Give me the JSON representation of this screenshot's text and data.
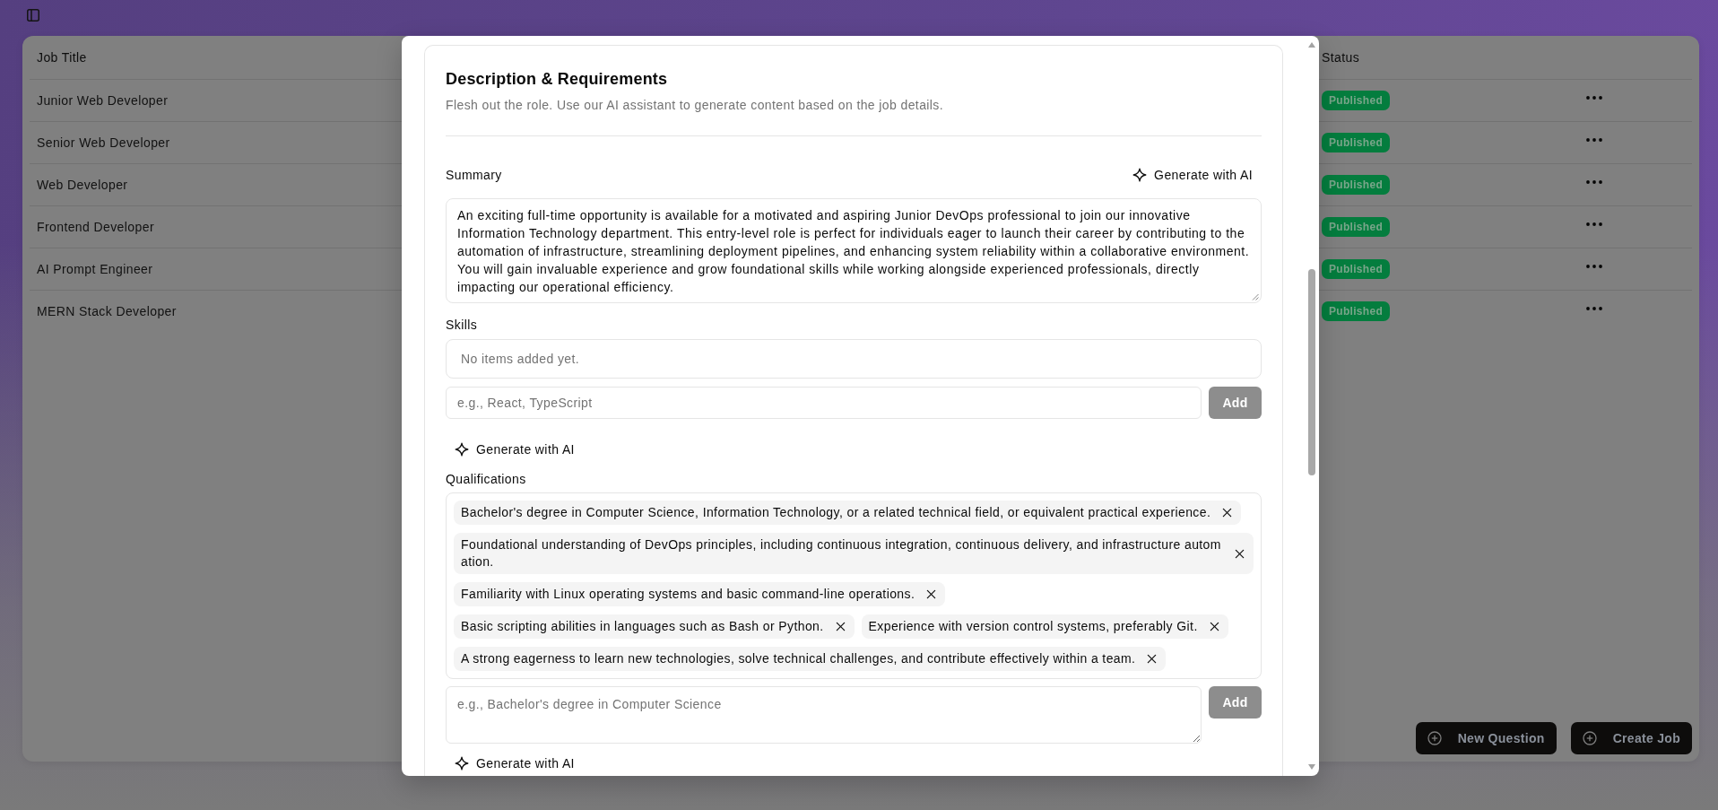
{
  "table": {
    "columns": [
      "Job Title",
      "Status"
    ],
    "rows": [
      {
        "job_title": "Junior Web Developer",
        "status": "Published"
      },
      {
        "job_title": "Senior Web Developer",
        "status": "Published"
      },
      {
        "job_title": "Web Developer",
        "status": "Published"
      },
      {
        "job_title": "Frontend Developer",
        "status": "Published"
      },
      {
        "job_title": "AI Prompt Engineer",
        "status": "Published"
      },
      {
        "job_title": "MERN Stack Developer",
        "status": "Published"
      }
    ]
  },
  "actions": [
    {
      "label": "New Question"
    },
    {
      "label": "Create Job"
    }
  ],
  "modal": {
    "section": {
      "title": "Description & Requirements",
      "subtitle": "Flesh out the role. Use our AI assistant to generate content based on the job details."
    },
    "summary": {
      "label": "Summary",
      "generate_button": "Generate with AI",
      "value": "An exciting full-time opportunity is available for a motivated and aspiring Junior DevOps professional to join our innovative Information Technology department. This entry-level role is perfect for individuals eager to launch their career by contributing to the automation of infrastructure, streamlining deployment pipelines, and enhancing system reliability within a collaborative environment. You will gain invaluable experience and grow foundational skills while working alongside experienced professionals, directly impacting our operational efficiency."
    },
    "skills": {
      "label": "Skills",
      "empty_text": "No items added yet.",
      "placeholder": "e.g., React, TypeScript",
      "add_button": {
        "label": "Add",
        "disabled": true
      },
      "generate_button": "Generate with AI"
    },
    "qualifications": {
      "label": "Qualifications",
      "items": [
        "Bachelor's degree in Computer Science, Information Technology, or a related technical field, or equivalent practical experience.",
        "Foundational understanding of DevOps principles, including continuous integration, continuous delivery, and infrastructure automation.",
        "Familiarity with Linux operating systems and basic command-line operations.",
        "Basic scripting abilities in languages such as Bash or Python.",
        "Experience with version control systems, preferably Git.",
        "A strong eagerness to learn new technologies, solve technical challenges, and contribute effectively within a team."
      ],
      "placeholder": "e.g., Bachelor's degree in Computer Science",
      "add_button": {
        "label": "Add",
        "disabled": true
      },
      "generate_button": "Generate with AI"
    }
  }
}
